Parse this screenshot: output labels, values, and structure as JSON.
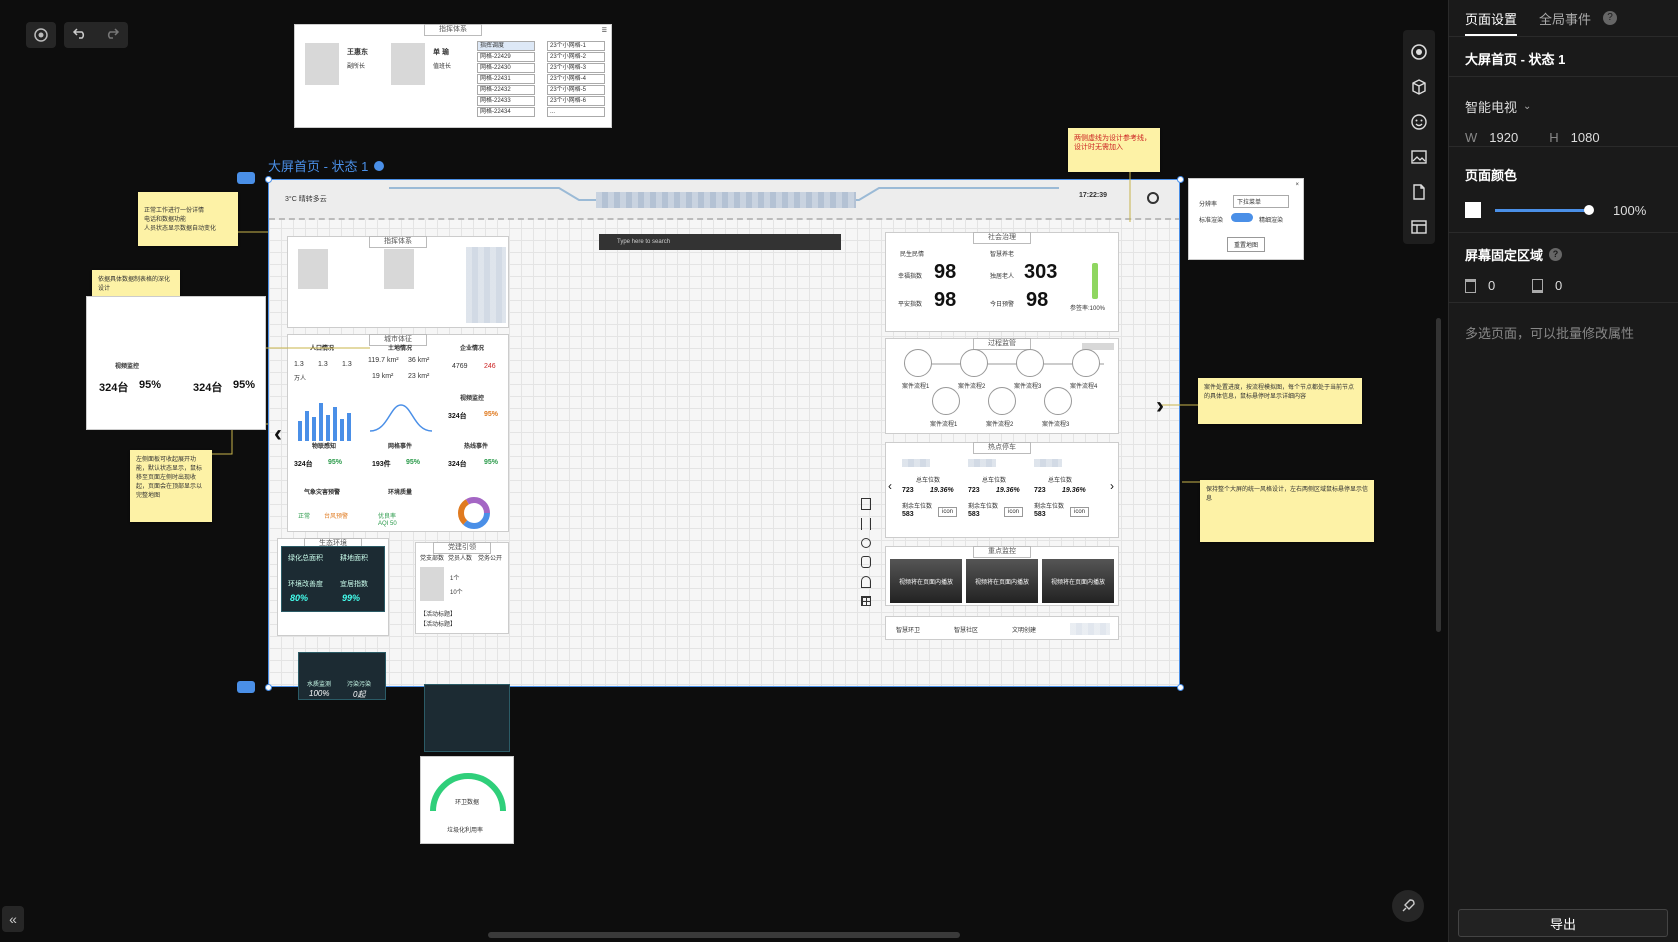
{
  "toolbar": {
    "target_icon": "target-icon",
    "undo_icon": "undo-icon",
    "redo_icon": "redo-icon"
  },
  "panel": {
    "tabs": [
      "页面设置",
      "全局事件"
    ],
    "page_name": "大屏首页 - 状态 1",
    "device": "智能电视",
    "width_label": "W",
    "width_value": "1920",
    "height_label": "H",
    "height_value": "1080",
    "page_color_label": "页面颜色",
    "opacity": "100%",
    "fixed_area_label": "屏幕固定区域",
    "fixed_top": "0",
    "fixed_bottom": "0",
    "hint": "多选页面，可以批量修改属性",
    "export_label": "导出"
  },
  "frame": {
    "title": "大屏首页 - 状态 1",
    "weather": "3°C 晴转多云",
    "time": "17:22:39",
    "search_placeholder": "Type here to search"
  },
  "notes": {
    "top_right": "两侧虚线为设计参考线，设计时无需加入",
    "left1": "正常工作进行一份详情\n电话和数据功能\n人员状态显示数据自动变化",
    "left2": "依据具体数据制表格的深化设计",
    "left3": "左侧面板可收起展开功能，默认状态显示，鼠标移至页面左侧时出现收起，页面会在顶部显示以完整地图",
    "right1": "案件处置进度，按流程模拟图，每个节点都处于当前节点的具体信息，鼠标悬停时显示详细内容",
    "right2": "保持整个大屏的统一风格设计，左右两侧区域鼠标悬停显示信息"
  },
  "top_card": {
    "title": "指挥体系",
    "person1": "王惠东",
    "role1": "副所长",
    "person2": "单 瑜",
    "role2": "值班长",
    "list1": [
      "指挥调度",
      "网格-22429",
      "网格-22430",
      "网格-22431",
      "网格-22432",
      "网格-22433",
      "网格-22434"
    ],
    "list2": [
      "23个小网格-1",
      "23个小网格-2",
      "23个小网格-3",
      "23个小网格-4",
      "23个小网格-5",
      "23个小网格-6",
      "..."
    ]
  },
  "left_widgets": {
    "command": "指挥体系",
    "city_sign": "城市体征",
    "population": "人口情况",
    "land": "土地情况",
    "enterprise": "企业情况",
    "pop_values": [
      "1.3",
      "1.3",
      "1.3"
    ],
    "pop_unit": "万人",
    "land_values": [
      "119.7 km²",
      "36 km²",
      "19 km²",
      "23 km²"
    ],
    "ent_values": [
      "4769",
      "246"
    ],
    "video": "视频监控",
    "video_values": [
      "324台",
      "95%"
    ],
    "grid_cases": "网格事件",
    "grid_values": [
      "193件",
      "95%"
    ],
    "hot_events": "热线事件",
    "hot_values": [
      "324台",
      "95%"
    ],
    "smart_perception": "物联感知",
    "perception_values": [
      "324台",
      "95%"
    ],
    "weather_warn": "气象灾害预警",
    "weather_values": [
      "正常",
      "台风预警"
    ],
    "env": "环境质量",
    "env_values": [
      "优良率",
      "AQI 50"
    ],
    "eco": "生态环境",
    "eco_items": [
      "绿化总面积",
      "耕地面积",
      "环境改善度",
      "宜居指数"
    ],
    "eco_values": [
      "80%",
      "99%"
    ],
    "eco_bottom": [
      "水质监测",
      "污染污染"
    ],
    "eco_bottom_values": [
      "100%",
      "0起"
    ],
    "legal": "党建引领",
    "legal_items": [
      "党支部数",
      "党员人数",
      "党务公开"
    ],
    "legal_counts": [
      "1个",
      "10个"
    ],
    "legal_rows": [
      "【活动标题】",
      "【活动标题】"
    ]
  },
  "right_widgets": {
    "social": "社会治理",
    "happiness_label": "幸福指数",
    "happiness": "98",
    "safety_label": "平安指数",
    "safety": "98",
    "elderly_label": "独居老人",
    "elderly": "303",
    "warning_label": "今日预警",
    "warning": "98",
    "rate_label": "参签率:100%",
    "headers": [
      "民生民情",
      "智慧养老"
    ],
    "process": "过程监管",
    "flows": [
      "案件流程1",
      "案件流程2",
      "案件流程3",
      "案件流程4",
      "案件流程1",
      "案件流程2",
      "案件流程3"
    ],
    "parking": "热点停车",
    "park_total_label": "总车位数",
    "park_total": "723",
    "park_pct": "19.36%",
    "park_free_label": "剩余车位数",
    "park_free": "583",
    "park_icon": "icon",
    "monitor": "重点监控",
    "monitor_labels": [
      "视频将在页面内播放",
      "视频将在页面内播放",
      "视频将在页面内播放"
    ],
    "bottom_tabs": [
      "智慧环卫",
      "智慧社区",
      "文明创建"
    ]
  },
  "right_popup": {
    "label1": "分辨率",
    "select": "下拉菜单",
    "label2": "标准渲染",
    "label3": "精细渲染",
    "button": "重置地图"
  },
  "floating_cards": {
    "gauge_title": "环卫数据",
    "gauge_label": "垃圾化利用率"
  },
  "colors": {
    "accent": "#4a8fe7",
    "panel_bg": "#1a1a1a",
    "canvas_bg": "#0d0d0d",
    "note_bg": "#fdf2a6"
  }
}
